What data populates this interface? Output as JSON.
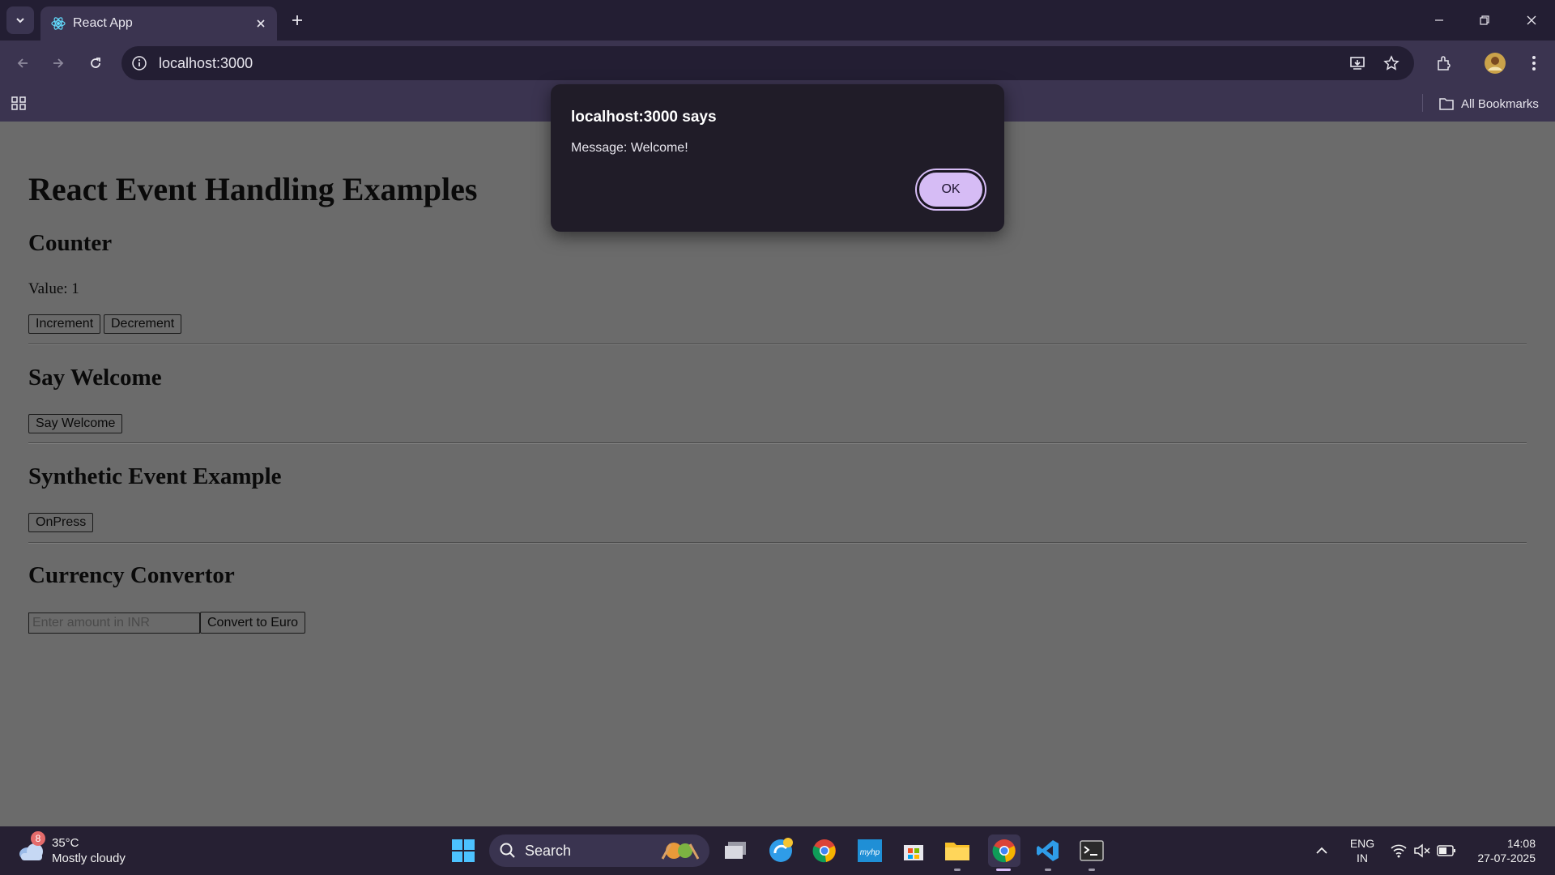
{
  "browser": {
    "tab_title": "React App",
    "url": "localhost:3000",
    "all_bookmarks": "All Bookmarks"
  },
  "page": {
    "title": "React Event Handling Examples",
    "counter": {
      "heading": "Counter",
      "value_text": "Value: 1",
      "increment": "Increment",
      "decrement": "Decrement"
    },
    "welcome": {
      "heading": "Say Welcome",
      "button": "Say Welcome"
    },
    "synthetic": {
      "heading": "Synthetic Event Example",
      "button": "OnPress"
    },
    "currency": {
      "heading": "Currency Convertor",
      "placeholder": "Enter amount in INR",
      "button": "Convert to Euro"
    }
  },
  "dialog": {
    "title": "localhost:3000 says",
    "message": "Message: Welcome!",
    "ok": "OK"
  },
  "taskbar": {
    "weather_temp": "35°C",
    "weather_desc": "Mostly cloudy",
    "weather_badge": "8",
    "search_label": "Search",
    "lang_1": "ENG",
    "lang_2": "IN",
    "time": "14:08",
    "date": "27-07-2025"
  },
  "colors": {
    "accent": "#d6bcf5",
    "chrome_dark": "#231e33",
    "chrome": "#3b3450",
    "page_bg": "#6b6b6b"
  }
}
